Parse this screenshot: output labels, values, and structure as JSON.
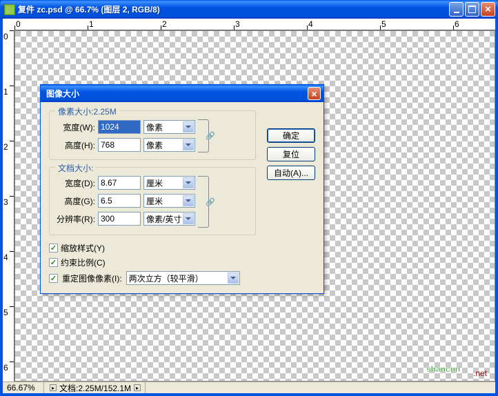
{
  "window": {
    "title": "复件 zc.psd @ 66.7% (图层 2, RGB/8)"
  },
  "ruler_h": [
    "0",
    "1",
    "2",
    "3",
    "4",
    "5",
    "6"
  ],
  "ruler_v": [
    "0",
    "1",
    "2",
    "3",
    "4",
    "5",
    "6"
  ],
  "statusbar": {
    "zoom": "66.67%",
    "doc": "文档:2.25M/152.1M"
  },
  "dialog": {
    "title": "图像大小",
    "pixel_dim": {
      "legend": "像素大小:2.25M",
      "width_label": "宽度(W):",
      "width_value": "1024",
      "width_unit": "像素",
      "height_label": "高度(H):",
      "height_value": "768",
      "height_unit": "像素"
    },
    "doc_dim": {
      "legend": "文档大小:",
      "width_label": "宽度(D):",
      "width_value": "8.67",
      "width_unit": "厘米",
      "height_label": "高度(G):",
      "height_value": "6.5",
      "height_unit": "厘米",
      "res_label": "分辨率(R):",
      "res_value": "300",
      "res_unit": "像素/英寸"
    },
    "checkboxes": {
      "scale_styles": "缩放样式(Y)",
      "constrain": "约束比例(C)",
      "resample": "重定图像像素(I):"
    },
    "resample_method": "两次立方（较平滑）",
    "buttons": {
      "ok": "确定",
      "reset": "复位",
      "auto": "自动(A)..."
    }
  },
  "watermark": "shancun.net"
}
